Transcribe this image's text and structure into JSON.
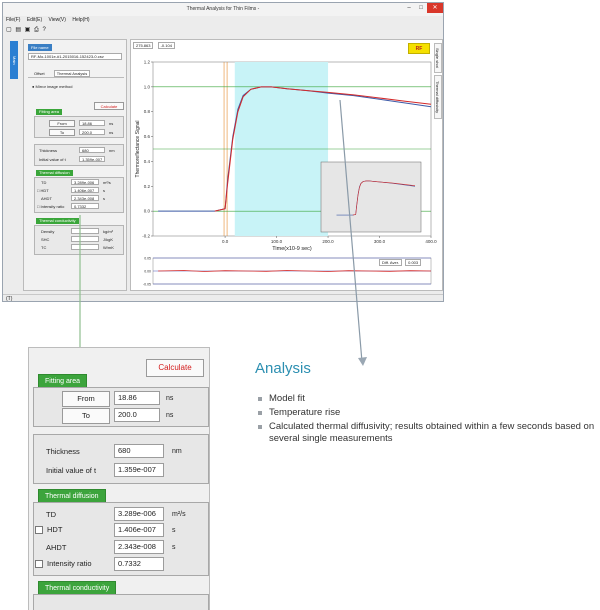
{
  "window": {
    "title": "Thermal Analysis for Thin Films -",
    "controls": {
      "minimize": "–",
      "maximize": "□",
      "close": "✕"
    },
    "menu": [
      "File(F)",
      "Edit(E)",
      "View(V)",
      "Help(H)"
    ],
    "toolbar_icons": [
      "new-file-icon",
      "open-folder-icon",
      "save-icon",
      "print-icon",
      "help-icon"
    ],
    "toolbar_glyphs": "▢ ▤ ▣ ⎙ ?",
    "status_text": "(T)",
    "left_tab": "Main",
    "right_tabs": [
      "Single shot",
      "Thermal diffusivity"
    ]
  },
  "left_panel": {
    "file_tab": "File name",
    "file_path": "RF-Mo-1001e-#1-2015016-152423-0.csv",
    "tabs": [
      "Offset",
      "Thermal Analysis"
    ],
    "method": "Mirror image method",
    "fitting_label": "Fitting area",
    "calculate": "Calculate",
    "from_label": "From",
    "from_value": "18.86",
    "to_label": "To",
    "to_value": "200.0",
    "unit_ns": "ns",
    "thickness_label": "Thickness",
    "thickness_value": "680",
    "thickness_unit": "nm",
    "initial_label": "Initial value of t",
    "initial_value": "1.359e-007",
    "diffusion_label": "Thermal diffusion",
    "td_label": "TD",
    "td_value": "3.289e-006",
    "td_unit": "m²/s",
    "hdt_label": "HDT",
    "hdt_value": "1.406e-007",
    "ahdt_label": "AHDT",
    "ahdt_value": "2.343e-008",
    "unit_s": "s",
    "intensity_label": "Intensity ratio",
    "intensity_value": "0.7332",
    "conductivity_label": "Thermal conductivity",
    "density_label": "Density",
    "density_unit": "kg/m³",
    "shc_label": "SHC",
    "shc_unit": "J/kgK",
    "tc_label": "TC",
    "tc_unit": "W/mK"
  },
  "plot": {
    "badge": "RF",
    "readout_x": "275.863",
    "readout_y": "-0.104",
    "residual_label": "Diff. Aver.",
    "residual_value": "0.003"
  },
  "zoom_panel": {
    "calculate": "Calculate",
    "fitting_label": "Fitting area",
    "from_label": "From",
    "from_value": "18.86",
    "to_label": "To",
    "to_value": "200.0",
    "unit_ns": "ns",
    "thickness_label": "Thickness",
    "thickness_value": "680",
    "thickness_unit": "nm",
    "initial_label": "Initial value of t",
    "initial_value": "1.359e-007",
    "diffusion_label": "Thermal diffusion",
    "td_label": "TD",
    "td_value": "3.289e-006",
    "td_unit": "m²/s",
    "hdt_label": "HDT",
    "hdt_value": "1.406e-007",
    "hdt_unit": "s",
    "ahdt_label": "AHDT",
    "ahdt_value": "2.343e-008",
    "ahdt_unit": "s",
    "intensity_label": "Intensity ratio",
    "intensity_value": "0.7332",
    "conductivity_label": "Thermal conductivity"
  },
  "analysis": {
    "title": "Analysis",
    "items": [
      "Model fit",
      "Temperature rise",
      "Calculated thermal diffusivity; results obtained within a few seconds based on several single measurements"
    ]
  },
  "colors": {
    "accent_blue": "#2b7fd2",
    "tab_green": "#3ca43c",
    "calculate_red": "#d31c1c",
    "analysis_title": "#2c8fb1",
    "highlight_cyan": "#c8f3f7",
    "measured_line": "#3d5aa8",
    "fit_line": "#d42a2a"
  },
  "chart_data": [
    {
      "type": "line",
      "title": "",
      "xlabel": "Time(x10-9 sec)",
      "ylabel": "Thermoreflectance Signal",
      "xlim": [
        0,
        400
      ],
      "ylim": [
        -0.2,
        1.2
      ],
      "x_ticks": [
        "0.0",
        "100.0",
        "200.0",
        "300.0",
        "400.0"
      ],
      "y_ticks": [
        "-0.2",
        "0.0",
        "0.2",
        "0.4",
        "0.6",
        "0.8",
        "1.0",
        "1.2"
      ],
      "highlight_x": [
        18.86,
        200
      ],
      "markers_x": [
        -2,
        0
      ],
      "marker_colors": [
        "#e48a2a",
        "#e48a2a"
      ],
      "hlines": [
        1.0,
        0.5,
        0.0
      ],
      "hline_colors": [
        "#3aa63a",
        "#3aa63a",
        "#3aa63a"
      ],
      "series": [
        {
          "color": "#3d5aa8",
          "x": [
            -130,
            -20,
            0,
            5,
            15,
            25,
            35,
            50,
            70,
            90,
            100,
            120,
            160,
            200,
            250,
            300,
            350,
            400
          ],
          "y": [
            0.0,
            0.0,
            0.02,
            0.25,
            0.6,
            0.82,
            0.93,
            0.98,
            1.0,
            1.0,
            0.995,
            0.985,
            0.97,
            0.95,
            0.93,
            0.9,
            0.87,
            0.84
          ]
        },
        {
          "color": "#d42a2a",
          "x": [
            -20,
            0,
            5,
            15,
            25,
            35,
            50,
            70,
            90,
            100,
            120,
            160,
            200,
            250,
            300,
            350,
            400
          ],
          "y": [
            0.0,
            0.02,
            0.22,
            0.58,
            0.8,
            0.92,
            0.98,
            1.0,
            1.0,
            0.995,
            0.985,
            0.97,
            0.955,
            0.935,
            0.91,
            0.885,
            0.86
          ]
        }
      ]
    },
    {
      "type": "line",
      "title": "",
      "ylim": [
        -0.05,
        0.05
      ],
      "y_ticks": [
        "0.05",
        "0.00",
        "-0.05"
      ],
      "series": [
        {
          "color": "#d42a2a",
          "x": [
            -130,
            -80,
            -40,
            0,
            40,
            80,
            120,
            160,
            200,
            240,
            280,
            320,
            360,
            400
          ],
          "y": [
            0.0,
            0.002,
            -0.002,
            0.001,
            0.0,
            -0.001,
            0.002,
            0.0,
            -0.002,
            0.001,
            0.0,
            -0.001,
            0.001,
            0.0
          ]
        }
      ]
    }
  ]
}
